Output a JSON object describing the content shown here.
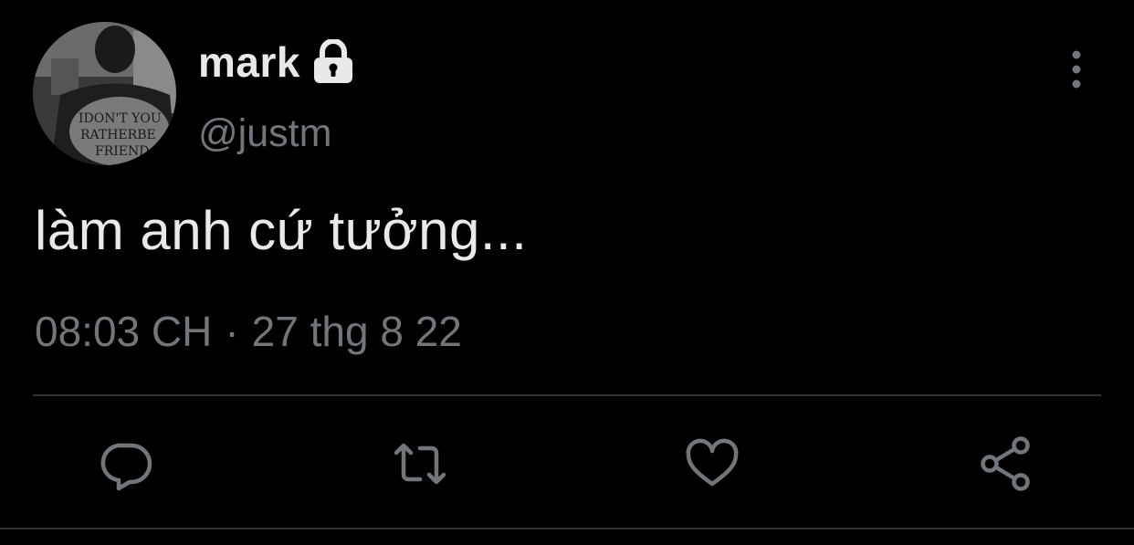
{
  "user": {
    "display_name": "mark",
    "handle": "@justm",
    "protected": true,
    "avatar_icon": "profile-photo"
  },
  "tweet": {
    "text": "làm anh cứ tưởng...",
    "time": "08:03 CH",
    "separator": "·",
    "date": "27 thg 8 22"
  },
  "actions": {
    "reply_icon": "reply-icon",
    "retweet_icon": "retweet-icon",
    "like_icon": "heart-icon",
    "share_icon": "share-icon"
  },
  "colors": {
    "background": "#000000",
    "primary_text": "#e7e9ea",
    "secondary_text": "#71767b",
    "divider": "#2f3336"
  }
}
